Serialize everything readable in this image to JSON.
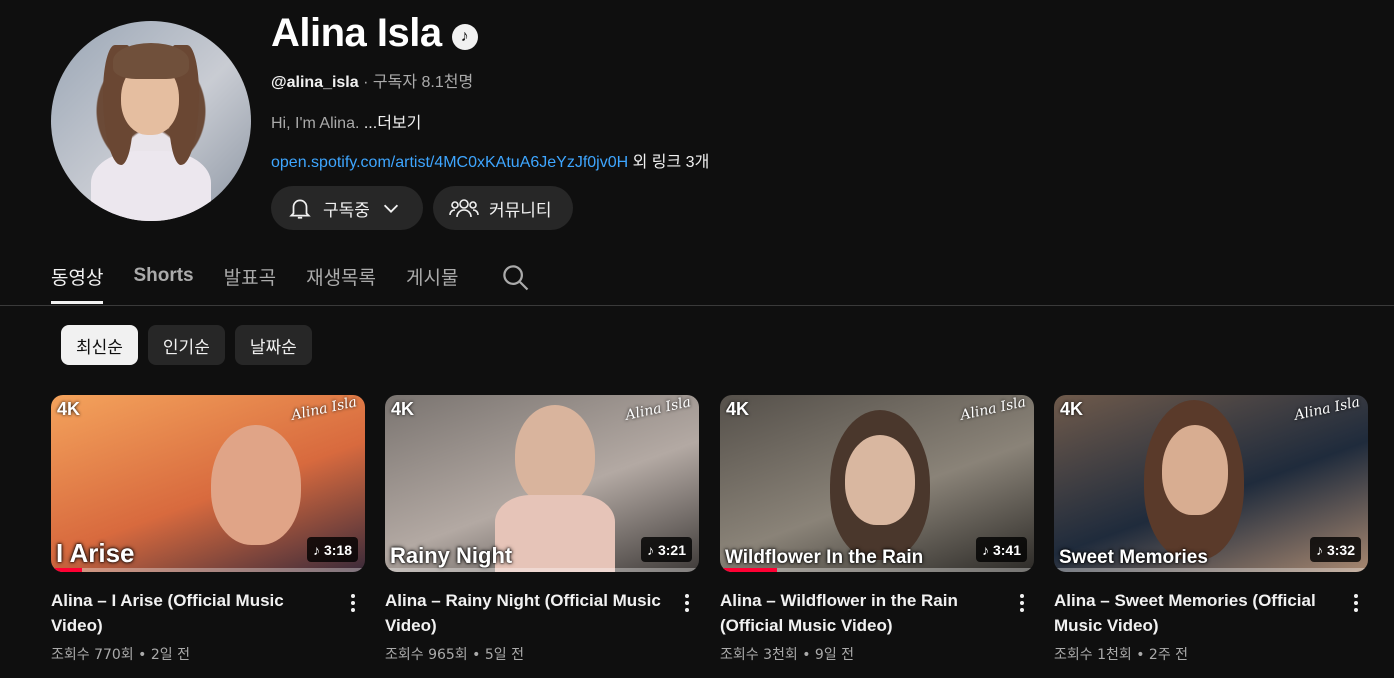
{
  "channel": {
    "name": "Alina Isla",
    "verified_icon": "music-note-icon",
    "handle": "@alina_isla",
    "meta_sep": " · ",
    "subscribers": "구독자 8.1천명",
    "description": "Hi, I'm Alina. ",
    "description_more": "...더보기",
    "link": "open.spotify.com/artist/4MC0xKAtuA6JeYzJf0jv0H",
    "more_links": " 외 링크 3개",
    "subscribe_label": "구독중",
    "community_label": "커뮤니티"
  },
  "tabs": [
    {
      "label": "동영상",
      "active": true
    },
    {
      "label": "Shorts",
      "active": false
    },
    {
      "label": "발표곡",
      "active": false
    },
    {
      "label": "재생목록",
      "active": false
    },
    {
      "label": "게시물",
      "active": false
    }
  ],
  "chips": [
    {
      "label": "최신순",
      "selected": true
    },
    {
      "label": "인기순",
      "selected": false
    },
    {
      "label": "날짜순",
      "selected": false
    }
  ],
  "videos": [
    {
      "badge": "4K",
      "signature": "Alina Isla",
      "overlay_title": "I Arise",
      "duration": "3:18",
      "title": "Alina – I Arise (Official Music Video)",
      "meta": "조회수 770회 • 2일 전",
      "progress": 0.1,
      "colors": [
        "#f4a35c",
        "#d86a3e",
        "#3a2a3a"
      ]
    },
    {
      "badge": "4K",
      "signature": "Alina Isla",
      "overlay_title": "Rainy Night",
      "duration": "3:21",
      "title": "Alina – Rainy Night (Official Music Video)",
      "meta": "조회수 965회 • 5일 전",
      "progress": 0.0,
      "colors": [
        "#7a7470",
        "#b3a9a3",
        "#3f3b39"
      ]
    },
    {
      "badge": "4K",
      "signature": "Alina Isla",
      "overlay_title": "Wildflower In the Rain",
      "duration": "3:41",
      "title": "Alina – Wildflower in the Rain (Official Music Video)",
      "meta": "조회수 3천회 • 9일 전",
      "progress": 0.18,
      "colors": [
        "#55504a",
        "#8a8378",
        "#2c2a27"
      ]
    },
    {
      "badge": "4K",
      "signature": "Alina Isla",
      "overlay_title": "Sweet Memories",
      "duration": "3:32",
      "title": "Alina – Sweet Memories (Official Music Video)",
      "meta": "조회수 1천회 • 2주 전",
      "progress": 0.0,
      "colors": [
        "#6f5a4b",
        "#1f2b3c",
        "#a88870"
      ]
    }
  ]
}
